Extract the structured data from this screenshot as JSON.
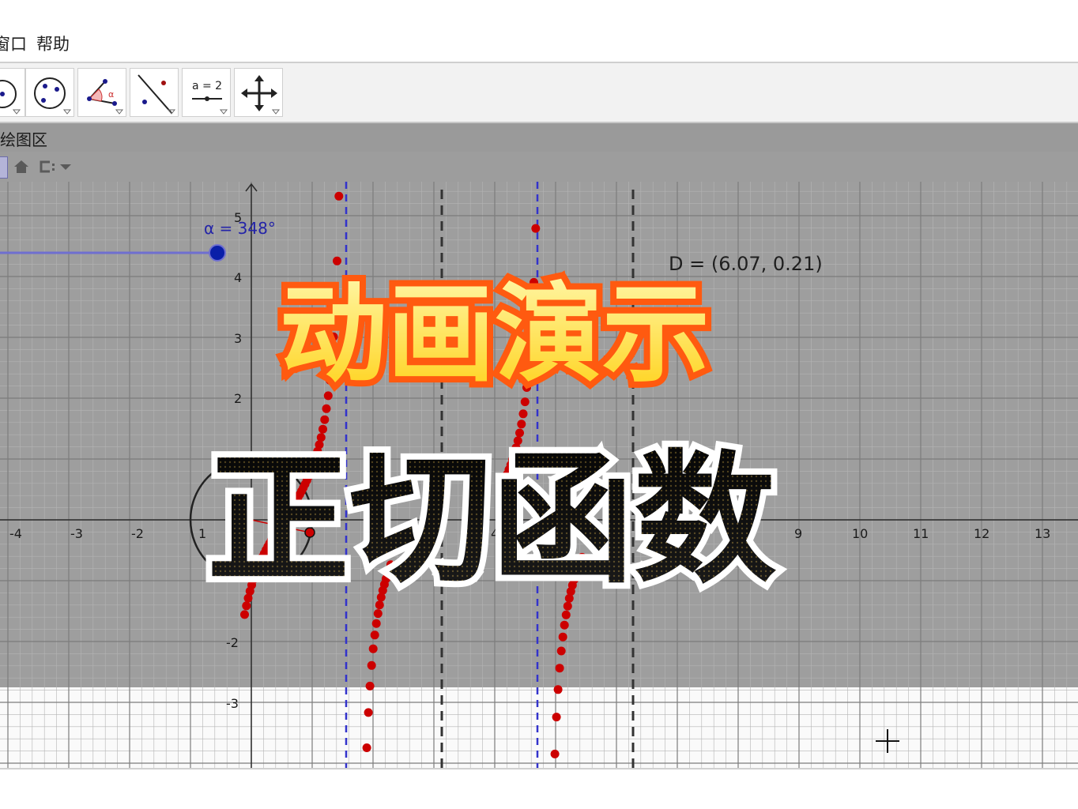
{
  "menu": {
    "items": [
      "窗口",
      "帮助"
    ]
  },
  "toolbar": {
    "tools": [
      "circle-tool-icon",
      "conic-tool-icon",
      "angle-tool-icon",
      "reflect-tool-icon",
      "slider-tool-icon",
      "move-graphics-tool-icon"
    ],
    "slider_label": "a = 2"
  },
  "view": {
    "title": "绘图区"
  },
  "graphics": {
    "x_ticks": [
      "-4",
      "-3",
      "-2",
      "1",
      "4",
      "9",
      "10",
      "11",
      "12",
      "13"
    ],
    "y_ticks": [
      "5",
      "4",
      "3",
      "2",
      "-2",
      "-3"
    ],
    "slider_label": "α = 348°",
    "slider_value": 348,
    "point_D_label": "D = (6.07, 0.21)",
    "colors": {
      "curve": "#cc0000",
      "asymptote_blue": "#3333cc",
      "asymptote_black": "#333333",
      "slider": "#0a1fa8"
    }
  },
  "overlay": {
    "title_line1": "动画演示",
    "title_line2": "正切函数"
  }
}
